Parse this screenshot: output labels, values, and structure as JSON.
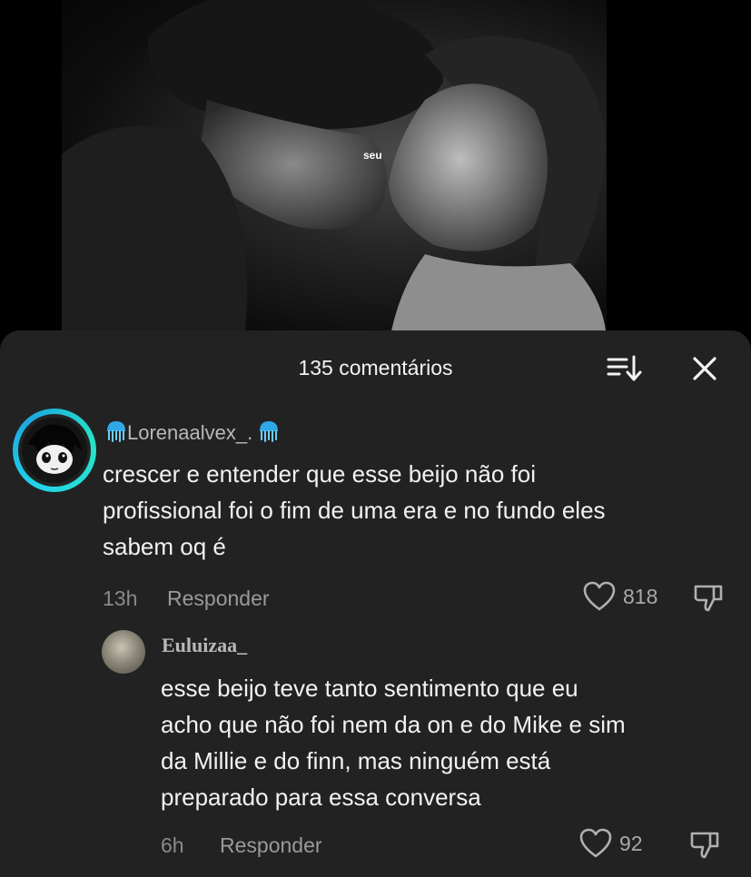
{
  "video": {
    "caption": "seu"
  },
  "comments_sheet": {
    "title": "135 comentários",
    "sort_icon": "sort-icon",
    "close_icon": "close-icon"
  },
  "comments": [
    {
      "username": "Lorenaalvex_.",
      "username_decor": "jellyfish-icon",
      "text": "crescer e entender que esse beijo não foi\nprofissional foi o fim de uma era e no fundo eles\nsabem oq é",
      "time": "13h",
      "reply_label": "Responder",
      "likes": "818"
    },
    {
      "username": "Euluizaa_",
      "text": "esse beijo teve tanto sentimento que eu\nacho que não foi nem da on e do Mike e sim\nda Millie e do finn, mas ninguém está\npreparado para essa conversa",
      "time": "6h",
      "reply_label": "Responder",
      "likes": "92"
    }
  ],
  "colors": {
    "sheet_bg": "#222222",
    "avatar_ring": "#23d5e8",
    "text": "#f2f2f2",
    "muted": "#8a8a8a"
  }
}
